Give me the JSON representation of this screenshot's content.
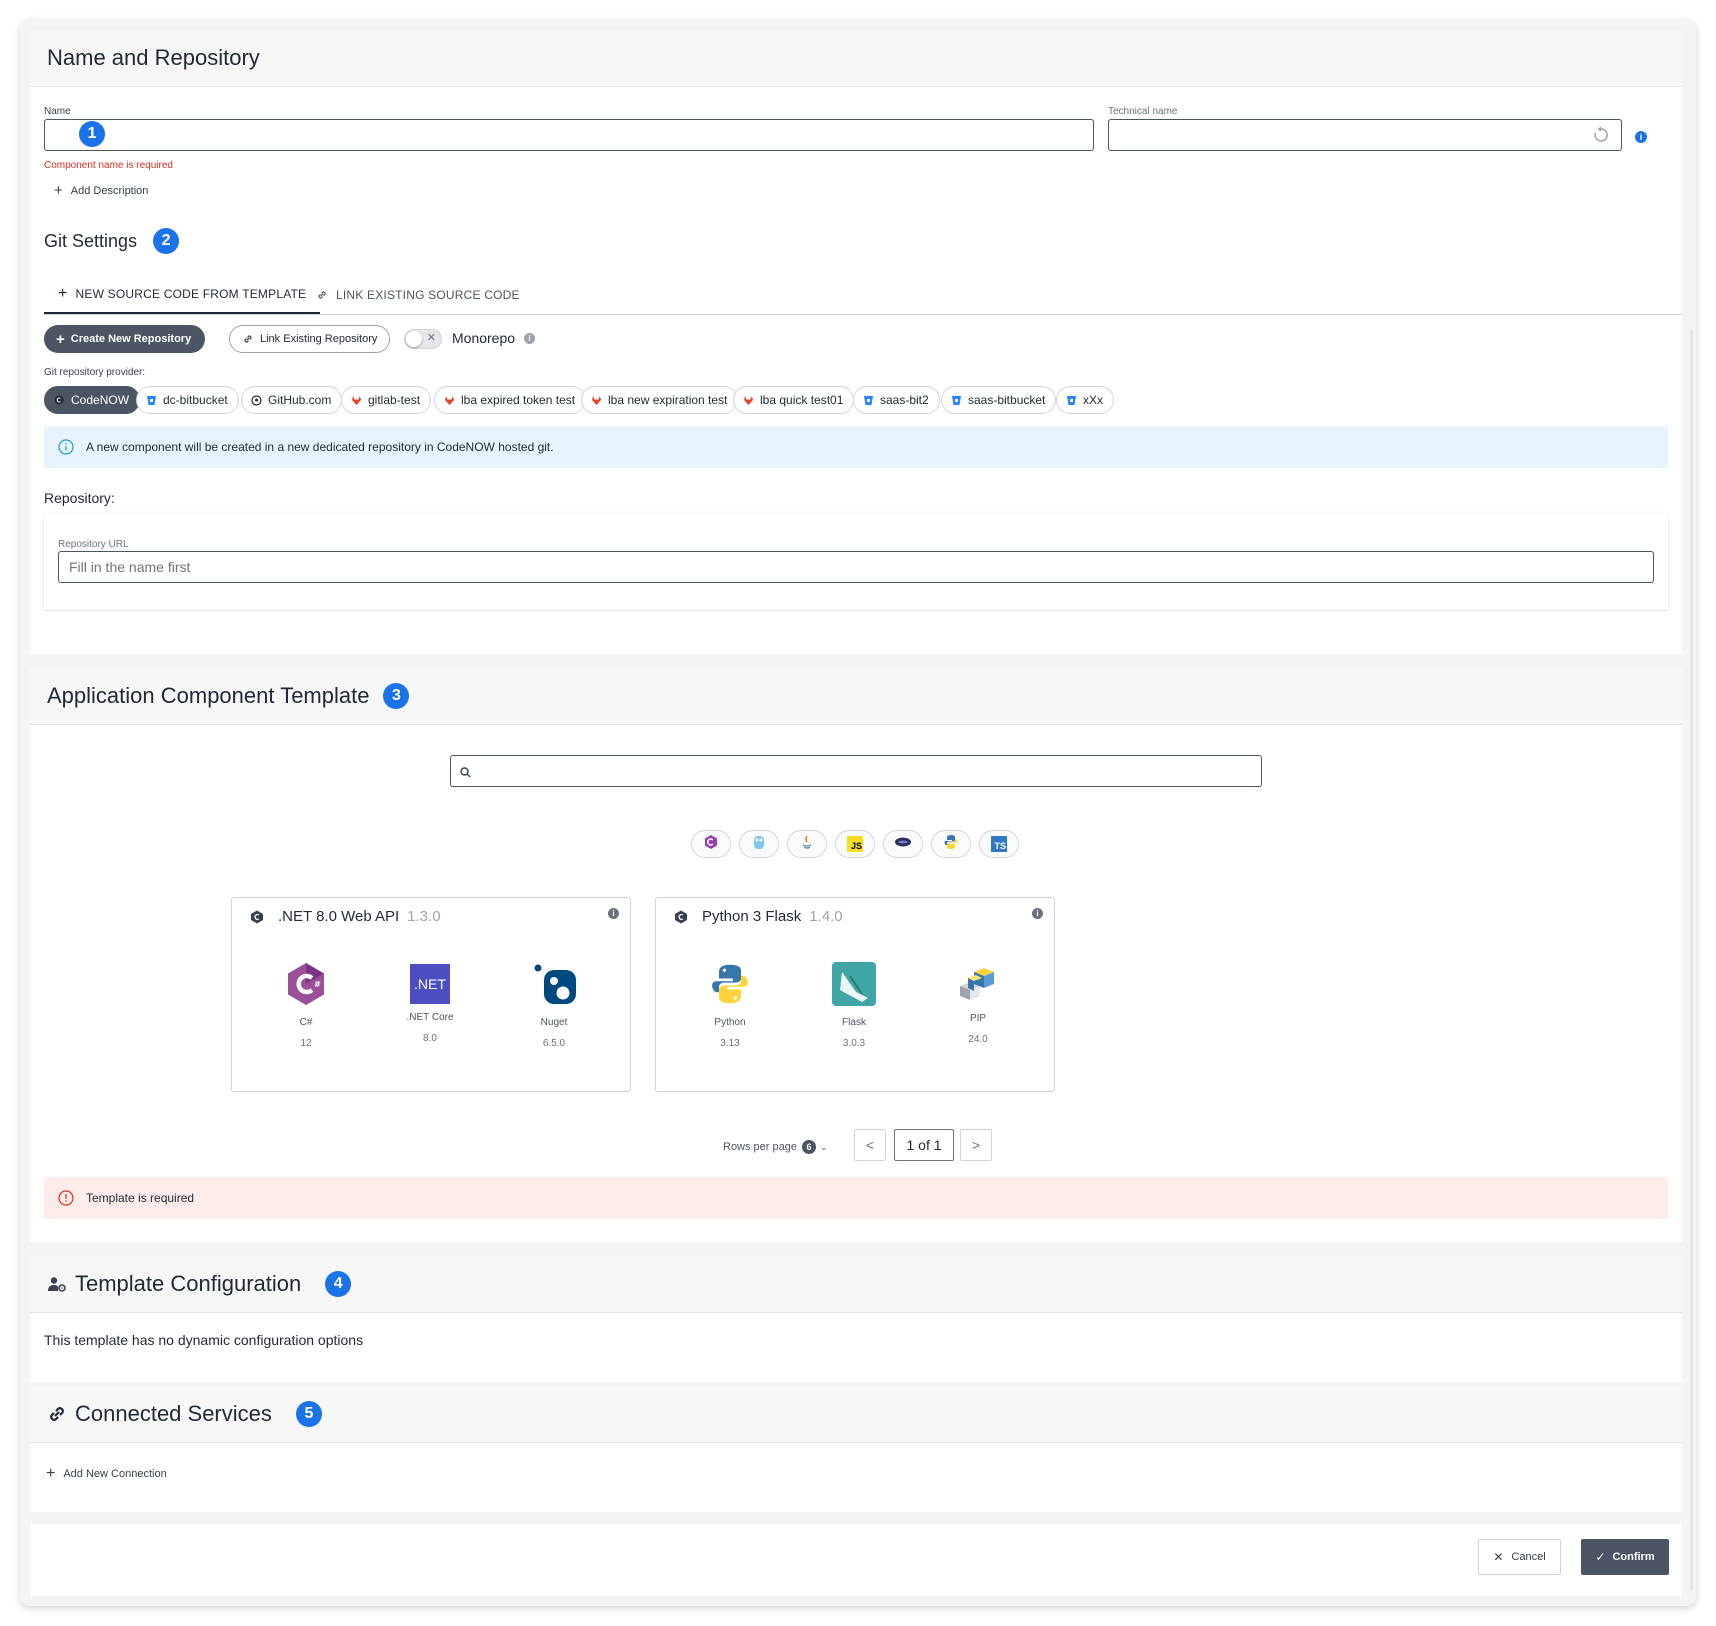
{
  "name_repo": {
    "title": "Name and Repository",
    "name_label": "Name",
    "name_value": "",
    "name_error": "Component name is required",
    "technical_label": "Technical name",
    "technical_value": "",
    "add_description": "Add Description",
    "badge": "1"
  },
  "git": {
    "title": "Git Settings",
    "badge": "2",
    "tabs": [
      {
        "label": "NEW SOURCE CODE FROM TEMPLATE",
        "active": true
      },
      {
        "label": "LINK EXISTING SOURCE CODE",
        "active": false
      }
    ],
    "create_repo_label": "Create New Repository",
    "link_repo_label": "Link Existing Repository",
    "monorepo_label": "Monorepo",
    "monorepo_on": false,
    "provider_label": "Git repository provider:",
    "providers": [
      {
        "label": "CodeNOW",
        "icon": "codenow-icon",
        "active": true
      },
      {
        "label": "dc-bitbucket",
        "icon": "bitbucket-icon"
      },
      {
        "label": "GitHub.com",
        "icon": "github-icon"
      },
      {
        "label": "gitlab-test",
        "icon": "gitlab-icon"
      },
      {
        "label": "lba expired token test",
        "icon": "gitlab-icon"
      },
      {
        "label": "lba new expiration test",
        "icon": "gitlab-icon"
      },
      {
        "label": "lba quick test01",
        "icon": "gitlab-icon"
      },
      {
        "label": "saas-bit2",
        "icon": "bitbucket-icon"
      },
      {
        "label": "saas-bitbucket",
        "icon": "bitbucket-icon"
      },
      {
        "label": "xXx",
        "icon": "bitbucket-icon"
      }
    ],
    "info_text": "A new component will be created in a new dedicated repository in CodeNOW hosted git.",
    "repository_label": "Repository:",
    "repo_url_label": "Repository URL",
    "repo_url_placeholder": "Fill in the name first"
  },
  "template": {
    "title": "Application Component Template",
    "badge": "3",
    "search_placeholder": "",
    "language_filters": [
      "csharp-icon",
      "go-icon",
      "java-icon",
      "javascript-icon",
      "kotlin-icon",
      "python-icon",
      "typescript-icon"
    ],
    "cards": [
      {
        "name": ".NET 8.0 Web API",
        "version": "1.3.0",
        "techs": [
          {
            "name": "C#",
            "version": "12",
            "icon": "csharp-icon"
          },
          {
            "name": ".NET Core",
            "version": "8.0",
            "icon": "dotnet-icon"
          },
          {
            "name": "Nuget",
            "version": "6.5.0",
            "icon": "nuget-icon"
          }
        ]
      },
      {
        "name": "Python 3 Flask",
        "version": "1.4.0",
        "techs": [
          {
            "name": "Python",
            "version": "3.13",
            "icon": "python-icon"
          },
          {
            "name": "Flask",
            "version": "3.0.3",
            "icon": "flask-icon"
          },
          {
            "name": "PIP",
            "version": "24.0",
            "icon": "pip-icon"
          }
        ]
      }
    ],
    "rows_per_page_label": "Rows per page",
    "rows_per_page_value": "6",
    "page_indicator": "1 of 1",
    "prev_label": "<",
    "next_label": ">",
    "error_text": "Template is required"
  },
  "config": {
    "title": "Template Configuration",
    "badge": "4",
    "text": "This template has no dynamic configuration options"
  },
  "services": {
    "title": "Connected Services",
    "badge": "5",
    "add_connection": "Add New Connection"
  },
  "footer": {
    "cancel_label": "Cancel",
    "confirm_label": "Confirm"
  },
  "colors": {
    "accent": "#1a73e8",
    "dark_button": "#4b5563",
    "error": "#d93025",
    "info_bg": "#e8f4fd",
    "error_bg": "#fdecea"
  }
}
